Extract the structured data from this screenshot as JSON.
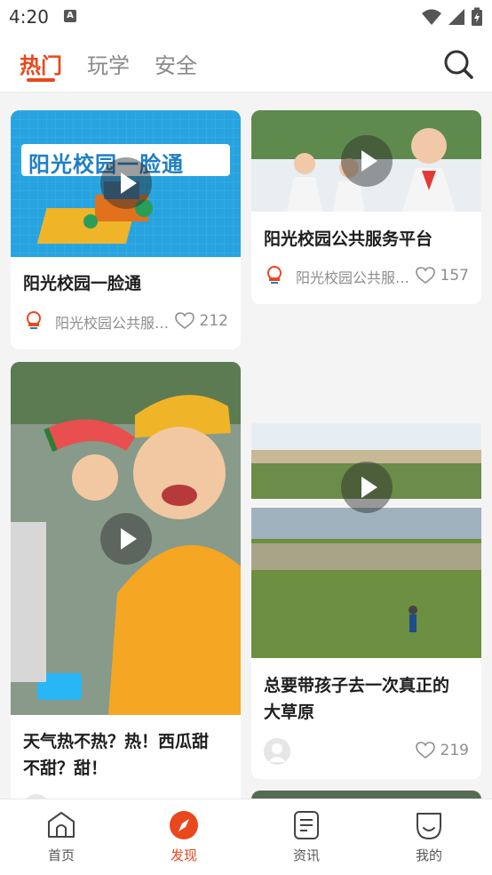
{
  "status_bar": {
    "time": "4:20"
  },
  "header": {
    "tabs": [
      {
        "label": "热门",
        "active": true
      },
      {
        "label": "玩学",
        "active": false
      },
      {
        "label": "安全",
        "active": false
      }
    ],
    "search_icon": "search-icon"
  },
  "feed": {
    "cards": [
      {
        "title": "阳光校园一脸通",
        "author": "阳光校园公共服…",
        "likes": "212",
        "poster_text": "阳光校园一脸通"
      },
      {
        "title": "阳光校园公共服务平台",
        "author": "阳光校园公共服…",
        "likes": "157"
      },
      {
        "title_line1": "天气热不热？热！西瓜甜",
        "title_line2": "不甜？甜！"
      },
      {
        "title_line1": "总要带孩子去一次真正的",
        "title_line2": "大草原",
        "likes": "219"
      }
    ]
  },
  "bottom_nav": {
    "items": [
      {
        "label": "首页",
        "icon": "home-icon"
      },
      {
        "label": "发现",
        "icon": "compass-icon",
        "active": true
      },
      {
        "label": "资讯",
        "icon": "news-icon"
      },
      {
        "label": "我的",
        "icon": "profile-icon"
      }
    ]
  },
  "colors": {
    "accent": "#e8481c",
    "background": "#f4f4f4"
  }
}
